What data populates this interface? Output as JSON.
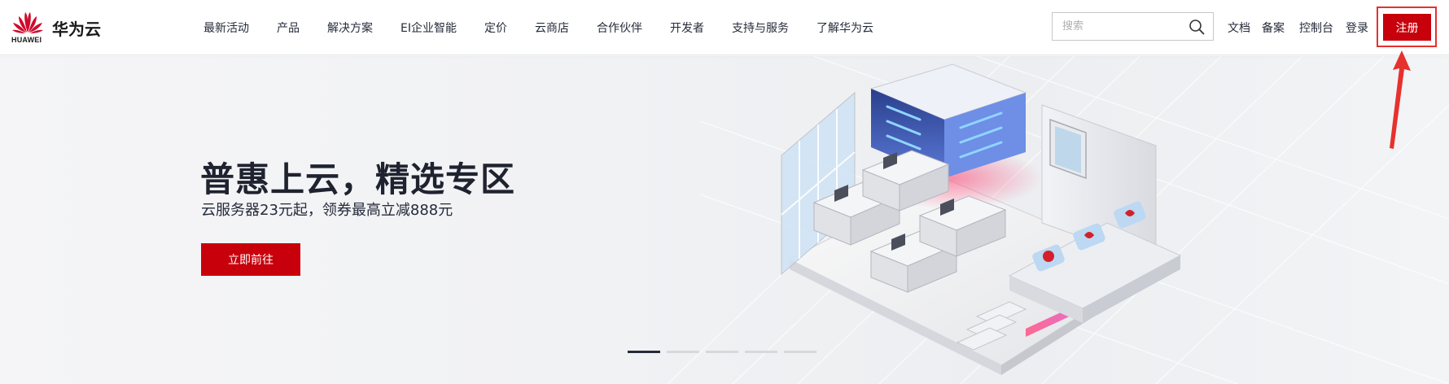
{
  "header": {
    "logo": {
      "brand_word": "HUAWEI",
      "brand_name": "华为云",
      "icon": "huawei-petal-logo"
    },
    "nav": [
      {
        "label": "最新活动"
      },
      {
        "label": "产品"
      },
      {
        "label": "解决方案"
      },
      {
        "label": "EI企业智能"
      },
      {
        "label": "定价"
      },
      {
        "label": "云商店"
      },
      {
        "label": "合作伙伴"
      },
      {
        "label": "开发者"
      },
      {
        "label": "支持与服务"
      },
      {
        "label": "了解华为云"
      }
    ],
    "search": {
      "placeholder": "搜索",
      "value": "",
      "icon": "search-icon"
    },
    "links": {
      "docs": "文档",
      "filing": "备案",
      "console": "控制台",
      "login": "登录",
      "register": "注册"
    }
  },
  "banner": {
    "title": "普惠上云，精选专区",
    "subtitle": "云服务器23元起，领券最高立减888元",
    "cta_label": "立即前往",
    "slides_total": 5,
    "active_slide": 1
  },
  "annotation": {
    "highlighted": "register-button",
    "color": "#e6312e"
  },
  "colors": {
    "brand_red": "#c7000b",
    "text_dark": "#252b3a",
    "annotation_red": "#e6312e"
  }
}
